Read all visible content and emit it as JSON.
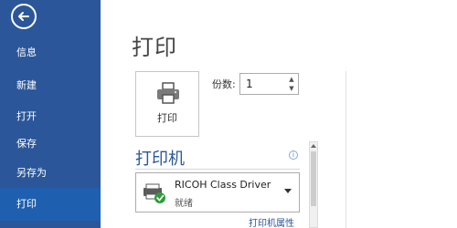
{
  "sidebar": {
    "items": [
      {
        "label": "信息"
      },
      {
        "label": "新建"
      },
      {
        "label": "打开"
      },
      {
        "label": "保存"
      },
      {
        "label": "另存为"
      },
      {
        "label": "打印",
        "active": true
      }
    ]
  },
  "main": {
    "title": "打印",
    "print_button_label": "打印",
    "copies": {
      "label": "份数:",
      "value": "1"
    },
    "printer_section": {
      "title": "打印机",
      "selected_printer": {
        "name": "RICOH Class Driver",
        "status": "就绪"
      },
      "properties_link": "打印机属性"
    }
  },
  "colors": {
    "sidebar_bg": "#2b579a",
    "accent": "#2b579a",
    "status_ok": "#2e9d3a"
  },
  "icons": [
    "back-arrow-icon",
    "printer-icon",
    "info-icon",
    "printer-ready-icon",
    "dropdown-arrow-icon"
  ]
}
